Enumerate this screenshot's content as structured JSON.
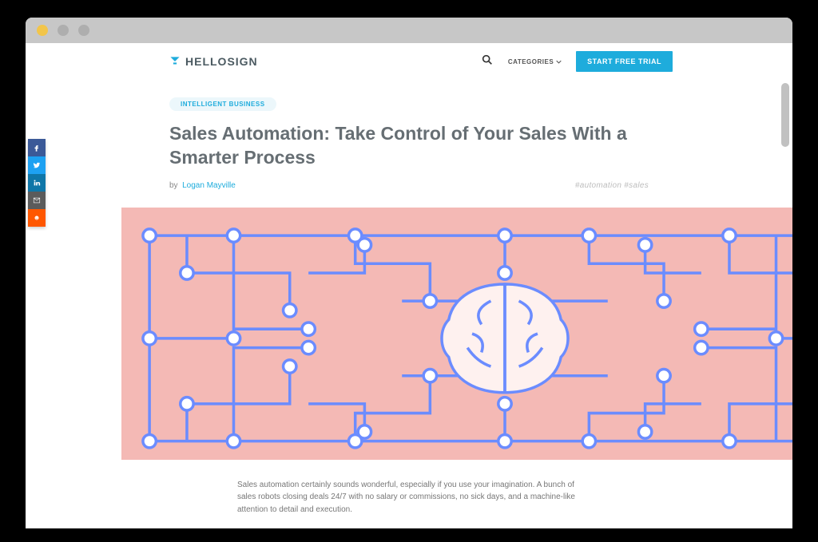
{
  "brand": {
    "text": "HELLOSIGN"
  },
  "nav": {
    "categories_label": "CATEGORIES",
    "cta_label": "START FREE TRIAL"
  },
  "share": {
    "items": [
      "facebook",
      "twitter",
      "linkedin",
      "email",
      "reddit"
    ]
  },
  "article": {
    "category_tag": "INTELLIGENT BUSINESS",
    "title": "Sales Automation: Take Control of Your Sales With a Smarter Process",
    "byline_prefix": "by",
    "author": "Logan Mayville",
    "tags_text": "#automation #sales",
    "body_p1": "Sales automation certainly sounds wonderful, especially if you use your imagination. A bunch of sales robots closing deals 24/7 with no salary or commissions, no sick days, and a machine-like attention to detail and execution."
  }
}
